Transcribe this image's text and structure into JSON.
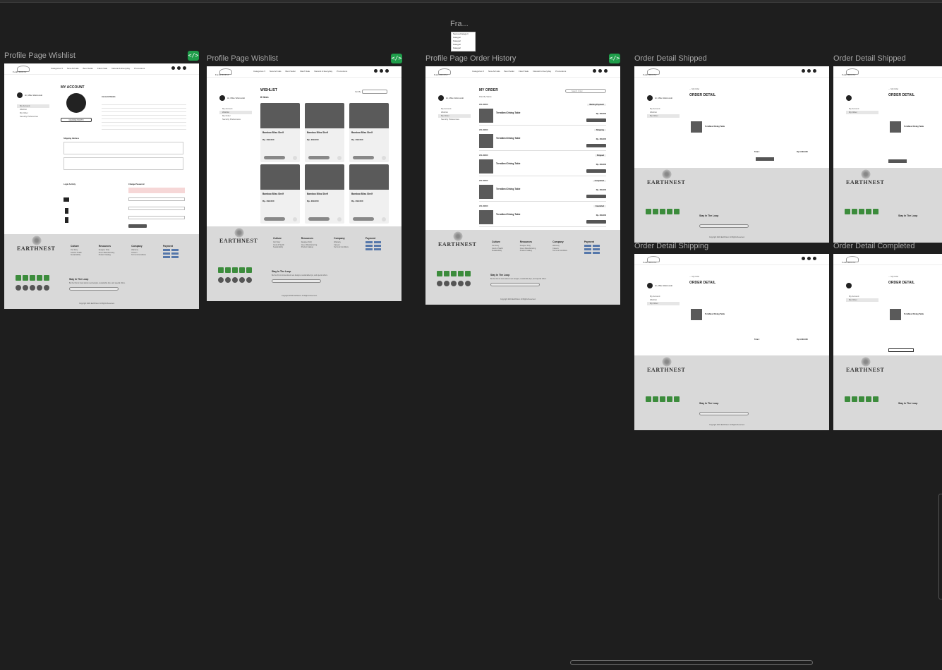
{
  "canvas": {
    "floating_frame_label": "Fra...",
    "floating_dropdown": [
      "Semua Kategori",
      "Kategori",
      "Kategori",
      "Kategori",
      "Kategori"
    ],
    "code_badge": "</>"
  },
  "frames": [
    {
      "label": "Profile Page Wishlist"
    },
    {
      "label": "Profile Page Wishlist"
    },
    {
      "label": "Profile Page Order History"
    },
    {
      "label": "Order Detail Shipped"
    },
    {
      "label": "Order Detail Shipped"
    },
    {
      "label": "Order Detail Shipping"
    },
    {
      "label": "Order Detail Completed"
    }
  ],
  "site": {
    "brand": "EARTHNEST",
    "nav": [
      "Categories ▾",
      "New Arrivals",
      "Best Seller",
      "Flash Sale",
      "Natural & Everyday",
      "Promotions",
      "Contact Us",
      "About ▾"
    ],
    "user": "Hi, Mike Wazowski",
    "sidebar": [
      "My Account",
      "Wishlist",
      "My Order",
      "Security Preferences"
    ]
  },
  "account": {
    "title": "MY ACCOUNT",
    "details_title": "Account Details",
    "change_photo": "CHANGE PHOTO",
    "shipping_title": "Shipping Address",
    "login_activity": "Login Activity",
    "change_password": "Change Password",
    "save_button": "Save Changes"
  },
  "wishlist": {
    "title": "WISHLIST",
    "count": "6 Item",
    "sort_label": "Sort By",
    "product_name": "Bamboo Bliss Shelf",
    "product_price": "Rp. 299.000",
    "view_detail": "View Detail"
  },
  "orders": {
    "title": "MY ORDER",
    "search_placeholder": "Search Order",
    "filter_label": "Filter By Status",
    "product_name": "TerraNest Dining Table",
    "rows": [
      {
        "id": "#01-00200",
        "status": "Waiting Payment",
        "price": "Rp. 339.000"
      },
      {
        "id": "#01-00200",
        "status": "Shipping",
        "price": "Rp. 339.000"
      },
      {
        "id": "#01-00200",
        "status": "Shipped",
        "price": "Rp. 339.000"
      },
      {
        "id": "#01-00200",
        "status": "Completed",
        "price": "Rp. 339.000"
      },
      {
        "id": "#01-00200",
        "status": "Cancelled",
        "price": "Rp. 339.000"
      }
    ]
  },
  "order_detail": {
    "back": "← My Order",
    "title": "ORDER DETAIL",
    "product_name": "TerraNest Dining Table",
    "total_label": "Total :",
    "total": "Rp 3.029.000"
  },
  "footer": {
    "columns": [
      {
        "title": "Culture",
        "items": [
          "Our Story",
          "Good & Health",
          "Sustainability",
          "Eco-Friendly Art Forest"
        ]
      },
      {
        "title": "Resources",
        "items": [
          "Designer FAQ",
          "Green Manufacturing",
          "Product Catalog",
          "Affiliate Login"
        ]
      },
      {
        "title": "Company",
        "items": [
          "Warranty",
          "Careers",
          "Terms & Conditions",
          "Privacy Policy",
          "Help Center"
        ]
      },
      {
        "title": "Payment",
        "items": []
      }
    ],
    "loop_title": "Stay In The Loop",
    "loop_sub": "Be the first to know about new designs, sustainable tips, and special offers.",
    "subscribe": "Subscribe",
    "copyright": "Copyright 2024 EarthNest. All Rights Reserved."
  }
}
